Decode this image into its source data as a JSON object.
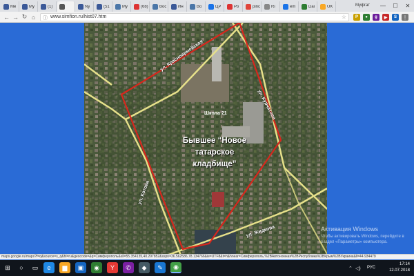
{
  "tabs": [
    {
      "label": "Me",
      "color": "#3b5998"
    },
    {
      "label": "My",
      "color": "#3b5998"
    },
    {
      "label": "(1)",
      "color": "#3b5998"
    },
    {
      "label": "",
      "color": "#555555"
    },
    {
      "label": "Ny",
      "color": "#3b5998"
    },
    {
      "label": "(51",
      "color": "#3b5998"
    },
    {
      "label": "My",
      "color": "#4a76a8"
    },
    {
      "label": "(68)",
      "color": "#d33"
    },
    {
      "label": "Вос",
      "color": "#4a76a8"
    },
    {
      "label": "Ин",
      "color": "#3b5998"
    },
    {
      "label": "Во",
      "color": "#4a76a8"
    },
    {
      "label": "ЦР",
      "color": "#1a73e8"
    },
    {
      "label": "Ро",
      "color": "#d33"
    },
    {
      "label": "pinc",
      "color": "#e0453b"
    },
    {
      "label": "Ri",
      "color": "#888"
    },
    {
      "label": "em",
      "color": "#1a73e8"
    },
    {
      "label": "Dai",
      "color": "#2e7d32"
    },
    {
      "label": "UK",
      "color": "#f9a825"
    }
  ],
  "window": {
    "profile": "Муфгат",
    "minimize": "—",
    "maximize": "☐",
    "close": "✕"
  },
  "toolbar": {
    "back": "←",
    "forward": "→",
    "reload": "↻",
    "home": "⌂",
    "url": "www.simfion.ru/hist07.htm",
    "star": "☆"
  },
  "extensions": [
    {
      "letter": "P",
      "color": "#c9a000"
    },
    {
      "letter": "●",
      "color": "#2e7d32"
    },
    {
      "letter": "g",
      "color": "#6a1b9a"
    },
    {
      "letter": "▶",
      "color": "#c62828"
    },
    {
      "letter": "S",
      "color": "#1565c0"
    },
    {
      "letter": "⋮",
      "color": "#777777"
    }
  ],
  "map": {
    "school_label": "Школа 21",
    "main_label": "Бывшее “Новое татарское кладбище”",
    "street_krasnoarmeyskaya": "ул. Красноармейская",
    "street_kurchatova": "ул. Курчатова",
    "street_kotova": "ул. Котова",
    "street_zhidkova": "ул. Жидкова"
  },
  "watermark": {
    "title": "Активация Windows",
    "body": "Чтобы активировать Windows, перейдите в раздел «Параметры» компьютера."
  },
  "statusbar": {
    "text": "maps.google.ru/maps?f=q&source=s_q&hl=ru&geocode=&q=Симферополь&sll=55.354135,40.297852&sspn=36.562586,78.134766&ie=UTF8&t=h&hnear=Симферополь,%2BАвтономная%2BРеспублика%2BКрым%2BУкраина&ll=44.934479"
  },
  "taskbar": {
    "items": [
      {
        "name": "start-icon",
        "glyph": "⊞",
        "color": "transparent"
      },
      {
        "name": "search-icon",
        "glyph": "○",
        "color": "transparent"
      },
      {
        "name": "task-view-icon",
        "glyph": "▭",
        "color": "transparent"
      },
      {
        "name": "edge-icon",
        "glyph": "e",
        "color": "#1e88e5"
      },
      {
        "name": "explorer-icon",
        "glyph": "▆",
        "color": "#f9a825"
      },
      {
        "name": "store-icon",
        "glyph": "▣",
        "color": "#1565c0"
      },
      {
        "name": "chrome-icon",
        "glyph": "◉",
        "color": "#2e7d32"
      },
      {
        "name": "yandex-icon",
        "glyph": "Y",
        "color": "#e53935"
      },
      {
        "name": "viber-icon",
        "glyph": "✆",
        "color": "#7b1fa2"
      },
      {
        "name": "photo-icon",
        "glyph": "◆",
        "color": "#455a64"
      },
      {
        "name": "paint-icon",
        "glyph": "✎",
        "color": "#1976d2"
      },
      {
        "name": "chrome-active-icon",
        "glyph": "◉",
        "color": "#43a047"
      }
    ],
    "lang": "РУС",
    "time": "17:14",
    "date": "12.07.2018"
  }
}
